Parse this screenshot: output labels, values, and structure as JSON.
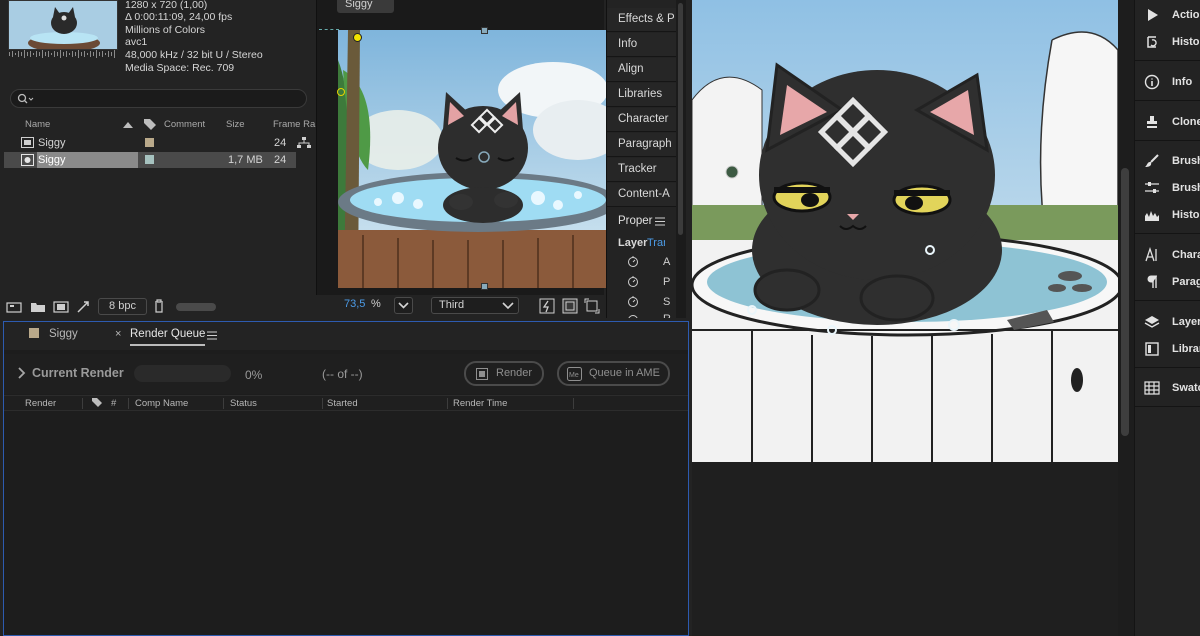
{
  "project": {
    "meta": {
      "resolution": "1280 x 720 (1,00)",
      "duration": "Δ 0:00:11:09, 24,00 fps",
      "colors": "Millions of Colors",
      "codec": "avc1",
      "audio": "48,000 kHz / 32 bit U / Stereo",
      "media_space": "Media Space: Rec. 709"
    },
    "search": {
      "placeholder": ""
    },
    "columns": {
      "name": "Name",
      "comment": "Comment",
      "size": "Size",
      "frame_rate": "Frame Ra."
    },
    "items": [
      {
        "name": "Siggy",
        "label_color": "#b9a98a",
        "size": "",
        "frame_rate": "24",
        "type": "composition"
      },
      {
        "name": "Siggy",
        "label_color": "#a6c2bf",
        "size": "1,7 MB",
        "frame_rate": "24",
        "type": "footage"
      }
    ],
    "bit_depth": "8 bpc"
  },
  "comp_viewer": {
    "tab": "Siggy",
    "zoom": "73,5",
    "zoom_unit": "%",
    "view_mode": "Third"
  },
  "side_stack": {
    "items": [
      "Effects & P",
      "Info",
      "Align",
      "Libraries",
      "Character",
      "Paragraph",
      "Tracker",
      "Content-A"
    ],
    "properties": {
      "title": "Proper",
      "layer_label": "Layer",
      "layer_value": "Tran",
      "rows": [
        "A",
        "P",
        "S",
        "R"
      ]
    }
  },
  "render_queue": {
    "tabs": [
      {
        "label": "Siggy",
        "color": "#b9a98a"
      },
      {
        "label": "Render Queue"
      }
    ],
    "current_render_label": "Current Render",
    "progress": 0,
    "progress_text": "0%",
    "count_text": "(-- of --)",
    "render_button": "Render",
    "ame_button": "Queue in AME",
    "columns": [
      "Render",
      "#",
      "Comp Name",
      "Status",
      "Started",
      "Render Time"
    ]
  },
  "dock": {
    "items": [
      {
        "label": "Actions",
        "icon": "play-icon"
      },
      {
        "label": "History",
        "icon": "history-icon"
      },
      {
        "label": "Info",
        "icon": "info-icon"
      },
      {
        "label": "Clone",
        "icon": "clone-stamp-icon"
      },
      {
        "label": "Brushes",
        "icon": "brush-icon"
      },
      {
        "label": "Brush",
        "icon": "brush-settings-icon"
      },
      {
        "label": "Histogram",
        "icon": "histogram-icon"
      },
      {
        "label": "Character",
        "icon": "character-icon"
      },
      {
        "label": "Paragraph",
        "icon": "paragraph-icon"
      },
      {
        "label": "Layers",
        "icon": "layers-icon"
      },
      {
        "label": "Libraries",
        "icon": "libraries-icon"
      },
      {
        "label": "Swatches",
        "icon": "swatches-icon"
      }
    ]
  },
  "colors": {
    "accent": "#4c9ce8",
    "panel": "#232323",
    "focus_border": "#2d5bb0"
  }
}
